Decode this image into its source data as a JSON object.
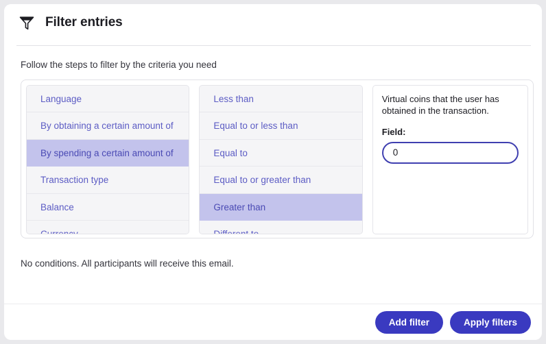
{
  "header": {
    "title": "Filter entries",
    "icon": "funnel-icon"
  },
  "subtitle": "Follow the steps to filter by the criteria you need",
  "criteria_list": {
    "items": [
      {
        "label": "Language",
        "selected": false
      },
      {
        "label": "By obtaining a certain amount of",
        "selected": false
      },
      {
        "label": "By spending a certain amount of",
        "selected": true
      },
      {
        "label": "Transaction type",
        "selected": false
      },
      {
        "label": "Balance",
        "selected": false
      },
      {
        "label": "Currency",
        "selected": false
      }
    ]
  },
  "operator_list": {
    "items": [
      {
        "label": "Less than",
        "selected": false
      },
      {
        "label": "Equal to or less than",
        "selected": false
      },
      {
        "label": "Equal to",
        "selected": false
      },
      {
        "label": "Equal to or greater than",
        "selected": false
      },
      {
        "label": "Greater than",
        "selected": true
      },
      {
        "label": "Different to",
        "selected": false
      }
    ]
  },
  "detail": {
    "description": "Virtual coins that the user has obtained in the transaction.",
    "field_label": "Field:",
    "field_value": "0",
    "field_placeholder": "0"
  },
  "status": "No conditions. All participants will receive this email.",
  "footer": {
    "add_filter_label": "Add filter",
    "apply_filters_label": "Apply filters"
  },
  "colors": {
    "accent": "#3a3ac0",
    "selected_row": "#c3c3ec",
    "list_text": "#5c5cc4",
    "row_bg": "#f5f5f7",
    "page_bg": "#e9e9ec"
  }
}
